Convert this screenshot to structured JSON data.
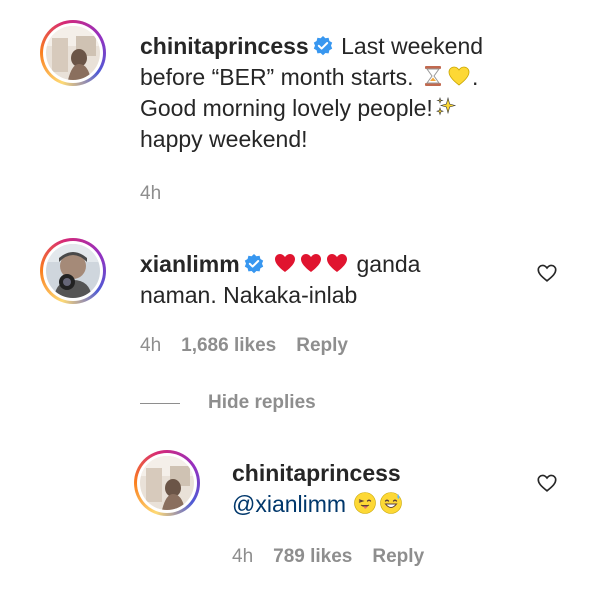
{
  "post_caption": {
    "username": "chinitaprincess",
    "text_line1": "Last weekend",
    "text_line2": "before “BER” month starts.",
    "text_line2_end": ".",
    "text_line3": "Good morning lovely people!",
    "text_line4": "happy weekend!",
    "time": "4h",
    "emojis": [
      "hourglass-icon",
      "yellow-heart-icon",
      "sparkles-icon"
    ]
  },
  "comment": {
    "username": "xianlimm",
    "text_after_hearts": "ganda",
    "text_line2": "naman. Nakaka-inlab",
    "time": "4h",
    "likes": "1,686 likes",
    "reply_label": "Reply",
    "emojis": [
      "red-heart-icon",
      "red-heart-icon",
      "red-heart-icon"
    ]
  },
  "hide_replies_label": "Hide replies",
  "reply": {
    "username": "chinitaprincess",
    "mention": "@xianlimm",
    "time": "4h",
    "likes": "789 likes",
    "reply_label": "Reply",
    "emojis": [
      "winking-tongue-face-icon",
      "grinning-sweat-face-icon"
    ]
  },
  "colors": {
    "verified": "#3897f0",
    "meta_text": "#8e8e8e",
    "mention": "#00376b",
    "red_heart": "#e0142f"
  }
}
